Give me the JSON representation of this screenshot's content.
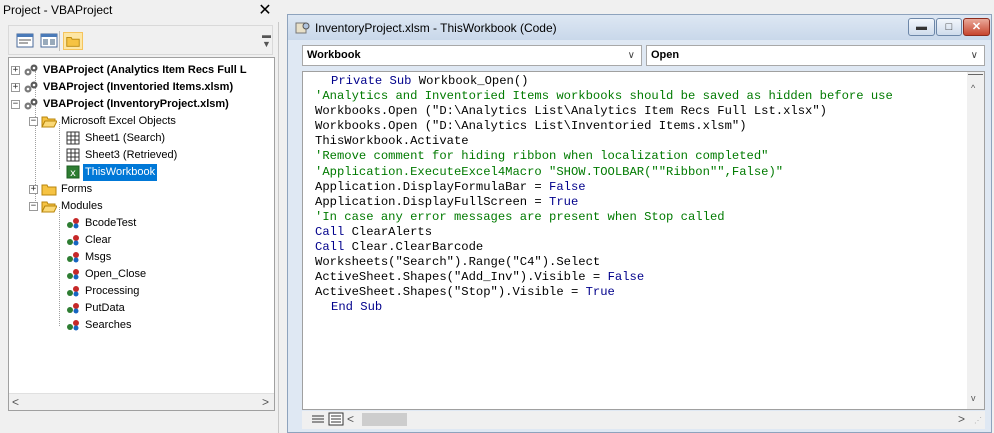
{
  "project_pane": {
    "title": "Project - VBAProject",
    "close_glyph": "✕",
    "toolbar": [
      "view-code-icon",
      "view-object-icon",
      "toggle-folders-icon"
    ],
    "tree": [
      {
        "label": "VBAProject (Analytics Item Recs Full L",
        "bold": true,
        "expander": "+"
      },
      {
        "label": "VBAProject (Inventoried Items.xlsm)",
        "bold": true,
        "expander": "+"
      },
      {
        "label": "VBAProject (InventoryProject.xlsm)",
        "bold": true,
        "expander": "−"
      },
      {
        "label": "Microsoft Excel Objects",
        "expander": "−"
      },
      {
        "label": "Sheet1 (Search)"
      },
      {
        "label": "Sheet3 (Retrieved)"
      },
      {
        "label": "ThisWorkbook",
        "selected": true
      },
      {
        "label": "Forms",
        "expander": "+"
      },
      {
        "label": "Modules",
        "expander": "−"
      },
      {
        "label": "BcodeTest"
      },
      {
        "label": "Clear"
      },
      {
        "label": "Msgs"
      },
      {
        "label": "Open_Close"
      },
      {
        "label": "Processing"
      },
      {
        "label": "PutData"
      },
      {
        "label": "Searches"
      }
    ],
    "scroll_left": "<",
    "scroll_right": ">"
  },
  "code_window": {
    "title": "InventoryProject.xlsm - ThisWorkbook (Code)",
    "buttons": {
      "minimize": "▬",
      "maximize": "□",
      "close": "✕"
    },
    "object_combo": "Workbook",
    "procedure_combo": "Open",
    "combo_arrow": "∨",
    "lines": [
      [
        {
          "k": "kw",
          "t": "Private Sub "
        },
        {
          "k": "",
          "t": "Workbook_Open()"
        }
      ],
      [
        {
          "k": "cm",
          "t": "'Analytics and Inventoried Items workbooks should be saved as hidden before use"
        }
      ],
      [
        {
          "k": "",
          "t": "Workbooks.Open (\"D:\\Analytics List\\Analytics Item Recs Full Lst.xlsx\")"
        }
      ],
      [
        {
          "k": "",
          "t": "Workbooks.Open (\"D:\\Analytics List\\Inventoried Items.xlsm\")"
        }
      ],
      [
        {
          "k": "",
          "t": "ThisWorkbook.Activate"
        }
      ],
      [
        {
          "k": "cm",
          "t": "'Remove comment for hiding ribbon when localization completed\""
        }
      ],
      [
        {
          "k": "cm",
          "t": "'Application.ExecuteExcel4Macro \"SHOW.TOOLBAR(\"\"Ribbon\"\",False)\""
        }
      ],
      [
        {
          "k": "",
          "t": "Application.DisplayFormulaBar = "
        },
        {
          "k": "kw",
          "t": "False"
        }
      ],
      [
        {
          "k": "",
          "t": "Application.DisplayFullScreen = "
        },
        {
          "k": "kw",
          "t": "True"
        }
      ],
      [
        {
          "k": "cm",
          "t": "'In case any error messages are present when Stop called"
        }
      ],
      [
        {
          "k": "kw",
          "t": "Call "
        },
        {
          "k": "",
          "t": "ClearAlerts"
        }
      ],
      [
        {
          "k": "kw",
          "t": "Call "
        },
        {
          "k": "",
          "t": "Clear.ClearBarcode"
        }
      ],
      [
        {
          "k": "",
          "t": "Worksheets(\"Search\").Range(\"C4\").Select"
        }
      ],
      [
        {
          "k": "",
          "t": "ActiveSheet.Shapes(\"Add_Inv\").Visible = "
        },
        {
          "k": "kw",
          "t": "False"
        }
      ],
      [
        {
          "k": "",
          "t": "ActiveSheet.Shapes(\"Stop\").Visible = "
        },
        {
          "k": "kw",
          "t": "True"
        }
      ],
      [
        {
          "k": "kw",
          "t": "End Sub"
        }
      ]
    ],
    "scroll_left": "<",
    "scroll_right": ">",
    "scroll_up": "^",
    "scroll_down": "v"
  },
  "colors": {
    "keyword": "#00008b",
    "comment": "#007a00",
    "selection": "#0078d7"
  }
}
